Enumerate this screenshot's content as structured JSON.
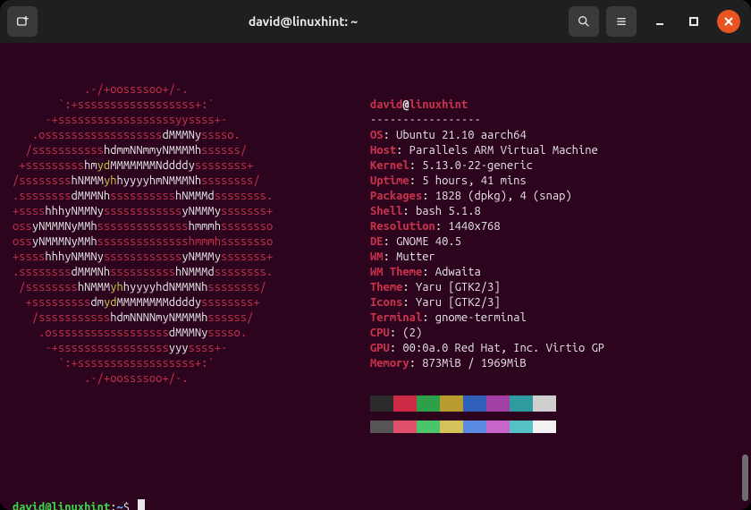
{
  "window": {
    "title": "david@linuxhint: ~"
  },
  "userhost": {
    "user": "david",
    "at": "@",
    "host": "linuxhint"
  },
  "dashline": "-----------------",
  "info": [
    {
      "k": "OS",
      "v": ": Ubuntu 21.10 aarch64"
    },
    {
      "k": "Host",
      "v": ": Parallels ARM Virtual Machine"
    },
    {
      "k": "Kernel",
      "v": ": 5.13.0-22-generic"
    },
    {
      "k": "Uptime",
      "v": ": 5 hours, 41 mins"
    },
    {
      "k": "Packages",
      "v": ": 1828 (dpkg), 4 (snap)"
    },
    {
      "k": "Shell",
      "v": ": bash 5.1.8"
    },
    {
      "k": "Resolution",
      "v": ": 1440x768"
    },
    {
      "k": "DE",
      "v": ": GNOME 40.5"
    },
    {
      "k": "WM",
      "v": ": Mutter"
    },
    {
      "k": "WM Theme",
      "v": ": Adwaita"
    },
    {
      "k": "Theme",
      "v": ": Yaru [GTK2/3]"
    },
    {
      "k": "Icons",
      "v": ": Yaru [GTK2/3]"
    },
    {
      "k": "Terminal",
      "v": ": gnome-terminal"
    },
    {
      "k": "CPU",
      "v": ": (2)"
    },
    {
      "k": "GPU",
      "v": ": 00:0a.0 Red Hat, Inc. Virtio GP"
    },
    {
      "k": "Memory",
      "v": ": 873MiB / 1969MiB"
    }
  ],
  "ascii": [
    [
      [
        "           ",
        "d"
      ],
      [
        ".-/+oossssoo+/-.",
        "r"
      ]
    ],
    [
      [
        "       ",
        "d"
      ],
      [
        "`:+ssssssssssssssssss+:`",
        "r"
      ]
    ],
    [
      [
        "     ",
        "d"
      ],
      [
        "-+ssssssssssssssssssyyssss+-",
        "r"
      ]
    ],
    [
      [
        "   ",
        "d"
      ],
      [
        ".ossssssssssssssssss",
        "r"
      ],
      [
        "dMMMNy",
        "w"
      ],
      [
        "sssso.",
        "r"
      ]
    ],
    [
      [
        "  ",
        "d"
      ],
      [
        "/sssssssssss",
        "r"
      ],
      [
        "hdmmNNmmyNMMMMh",
        "w"
      ],
      [
        "ssssss/",
        "r"
      ]
    ],
    [
      [
        " ",
        "d"
      ],
      [
        "+sssssssss",
        "r"
      ],
      [
        "hm",
        "w"
      ],
      [
        "yd",
        "y"
      ],
      [
        "MMMMMMMNddddy",
        "w"
      ],
      [
        "ssssssss+",
        "r"
      ]
    ],
    [
      [
        "/ssssssss",
        "r"
      ],
      [
        "hNMMM",
        "w"
      ],
      [
        "yh",
        "y"
      ],
      [
        "hyyyyhmNMMMNh",
        "w"
      ],
      [
        "ssssssss/",
        "r"
      ]
    ],
    [
      [
        ".ssssssss",
        "r"
      ],
      [
        "dMMMNh",
        "w"
      ],
      [
        "ssssssssss",
        "r"
      ],
      [
        "hNMMMd",
        "w"
      ],
      [
        "ssssssss.",
        "r"
      ]
    ],
    [
      [
        "+ssss",
        "r"
      ],
      [
        "hhhyNMMNy",
        "w"
      ],
      [
        "ssssssssssss",
        "r"
      ],
      [
        "yNMMMy",
        "w"
      ],
      [
        "sssssss+",
        "r"
      ]
    ],
    [
      [
        "oss",
        "r"
      ],
      [
        "yNMMMNyMMh",
        "w"
      ],
      [
        "ssssssssssssss",
        "r"
      ],
      [
        "hmmmh",
        "w"
      ],
      [
        "ssssssso",
        "r"
      ]
    ],
    [
      [
        "oss",
        "r"
      ],
      [
        "yNMMMNyMMh",
        "w"
      ],
      [
        "sssssssssssssshmmmh",
        "r"
      ],
      [
        "ssssssso",
        "r"
      ]
    ],
    [
      [
        "+ssss",
        "r"
      ],
      [
        "hhhyNMMNy",
        "w"
      ],
      [
        "ssssssssssss",
        "r"
      ],
      [
        "yNMMMy",
        "w"
      ],
      [
        "sssssss+",
        "r"
      ]
    ],
    [
      [
        ".ssssssss",
        "r"
      ],
      [
        "dMMMNh",
        "w"
      ],
      [
        "ssssssssss",
        "r"
      ],
      [
        "hNMMMd",
        "w"
      ],
      [
        "ssssssss.",
        "r"
      ]
    ],
    [
      [
        " /ssssssss",
        "r"
      ],
      [
        "hNMMM",
        "w"
      ],
      [
        "yh",
        "y"
      ],
      [
        "hyyyyhdNMMMNh",
        "w"
      ],
      [
        "ssssssss/",
        "r"
      ]
    ],
    [
      [
        "  +sssssssss",
        "r"
      ],
      [
        "dm",
        "w"
      ],
      [
        "yd",
        "y"
      ],
      [
        "MMMMMMMMddddy",
        "w"
      ],
      [
        "ssssssss+",
        "r"
      ]
    ],
    [
      [
        "   /sssssssssss",
        "r"
      ],
      [
        "hdmNNNNmyNMMMMh",
        "w"
      ],
      [
        "ssssss/",
        "r"
      ]
    ],
    [
      [
        "    ",
        "d"
      ],
      [
        ".ossssssssssssssssss",
        "r"
      ],
      [
        "dMMMNy",
        "w"
      ],
      [
        "sssso.",
        "r"
      ]
    ],
    [
      [
        "     ",
        "d"
      ],
      [
        "-+sssssssssssssssss",
        "r"
      ],
      [
        "yyy",
        "w"
      ],
      [
        "ssss+-",
        "r"
      ]
    ],
    [
      [
        "       ",
        "d"
      ],
      [
        "`:+ssssssssssssssssss+:`",
        "r"
      ]
    ],
    [
      [
        "           ",
        "d"
      ],
      [
        ".-/+oossssoo+/-.",
        "r"
      ]
    ]
  ],
  "swatches_top": [
    "#2b2b2b",
    "#cc2945",
    "#2ea04a",
    "#b99c2f",
    "#2f5fb8",
    "#a23fa2",
    "#2f9aa0",
    "#cfcfcf"
  ],
  "swatches_bottom": [
    "#555555",
    "#e0506a",
    "#4bc46a",
    "#d6c25a",
    "#5a8be0",
    "#c865c8",
    "#55c0c6",
    "#f2f2f2"
  ],
  "prompt": {
    "userhost": "david@linuxhint",
    "sep1": ":",
    "path": "~",
    "sep2": "$ "
  }
}
